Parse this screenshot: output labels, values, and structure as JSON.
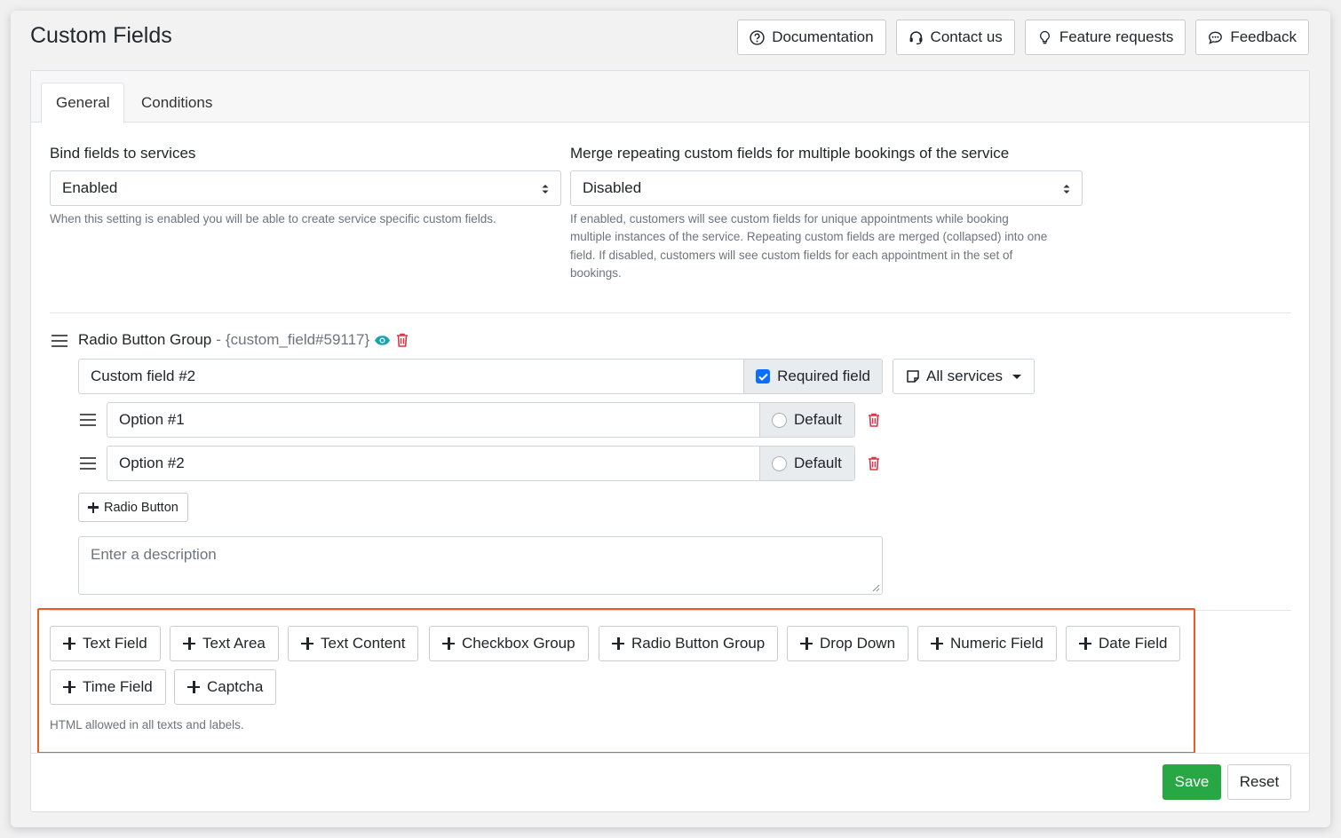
{
  "page": {
    "title": "Custom Fields"
  },
  "top_buttons": [
    {
      "label": "Documentation",
      "icon": "question-circle-icon"
    },
    {
      "label": "Contact us",
      "icon": "headset-icon"
    },
    {
      "label": "Feature requests",
      "icon": "lightbulb-icon"
    },
    {
      "label": "Feedback",
      "icon": "chat-icon"
    }
  ],
  "tabs": [
    {
      "label": "General",
      "active": true
    },
    {
      "label": "Conditions",
      "active": false
    }
  ],
  "settings": {
    "bind": {
      "label": "Bind fields to services",
      "value": "Enabled",
      "help": "When this setting is enabled you will be able to create service specific custom fields."
    },
    "merge": {
      "label": "Merge repeating custom fields for multiple bookings of the service",
      "value": "Disabled",
      "help_lines": [
        "If enabled, customers will see custom fields for unique appointments while booking",
        "multiple instances of the service. Repeating custom fields are merged (collapsed) into one",
        "field. If disabled, customers will see custom fields for each appointment in the set of",
        "bookings."
      ]
    }
  },
  "field": {
    "type": "Radio Button Group",
    "separator": "-",
    "code": "{custom_field#59117}",
    "name_value": "Custom field #2",
    "required_label": "Required field",
    "required_checked": true,
    "services_label": "All services",
    "options": [
      {
        "value": "Option #1",
        "default_label": "Default"
      },
      {
        "value": "Option #2",
        "default_label": "Default"
      }
    ],
    "add_option_label": "Radio Button",
    "description_placeholder": "Enter a description"
  },
  "add_buttons": [
    "Text Field",
    "Text Area",
    "Text Content",
    "Checkbox Group",
    "Radio Button Group",
    "Drop Down",
    "Numeric Field",
    "Date Field",
    "Time Field",
    "Captcha"
  ],
  "html_note": "HTML allowed in all texts and labels.",
  "footer": {
    "save_label": "Save",
    "reset_label": "Reset"
  },
  "colors": {
    "save": "#28a745",
    "danger": "#dc3545",
    "accent_eye": "#17a2b8",
    "highlight": "#f05a22",
    "checkbox": "#0d6efd"
  }
}
